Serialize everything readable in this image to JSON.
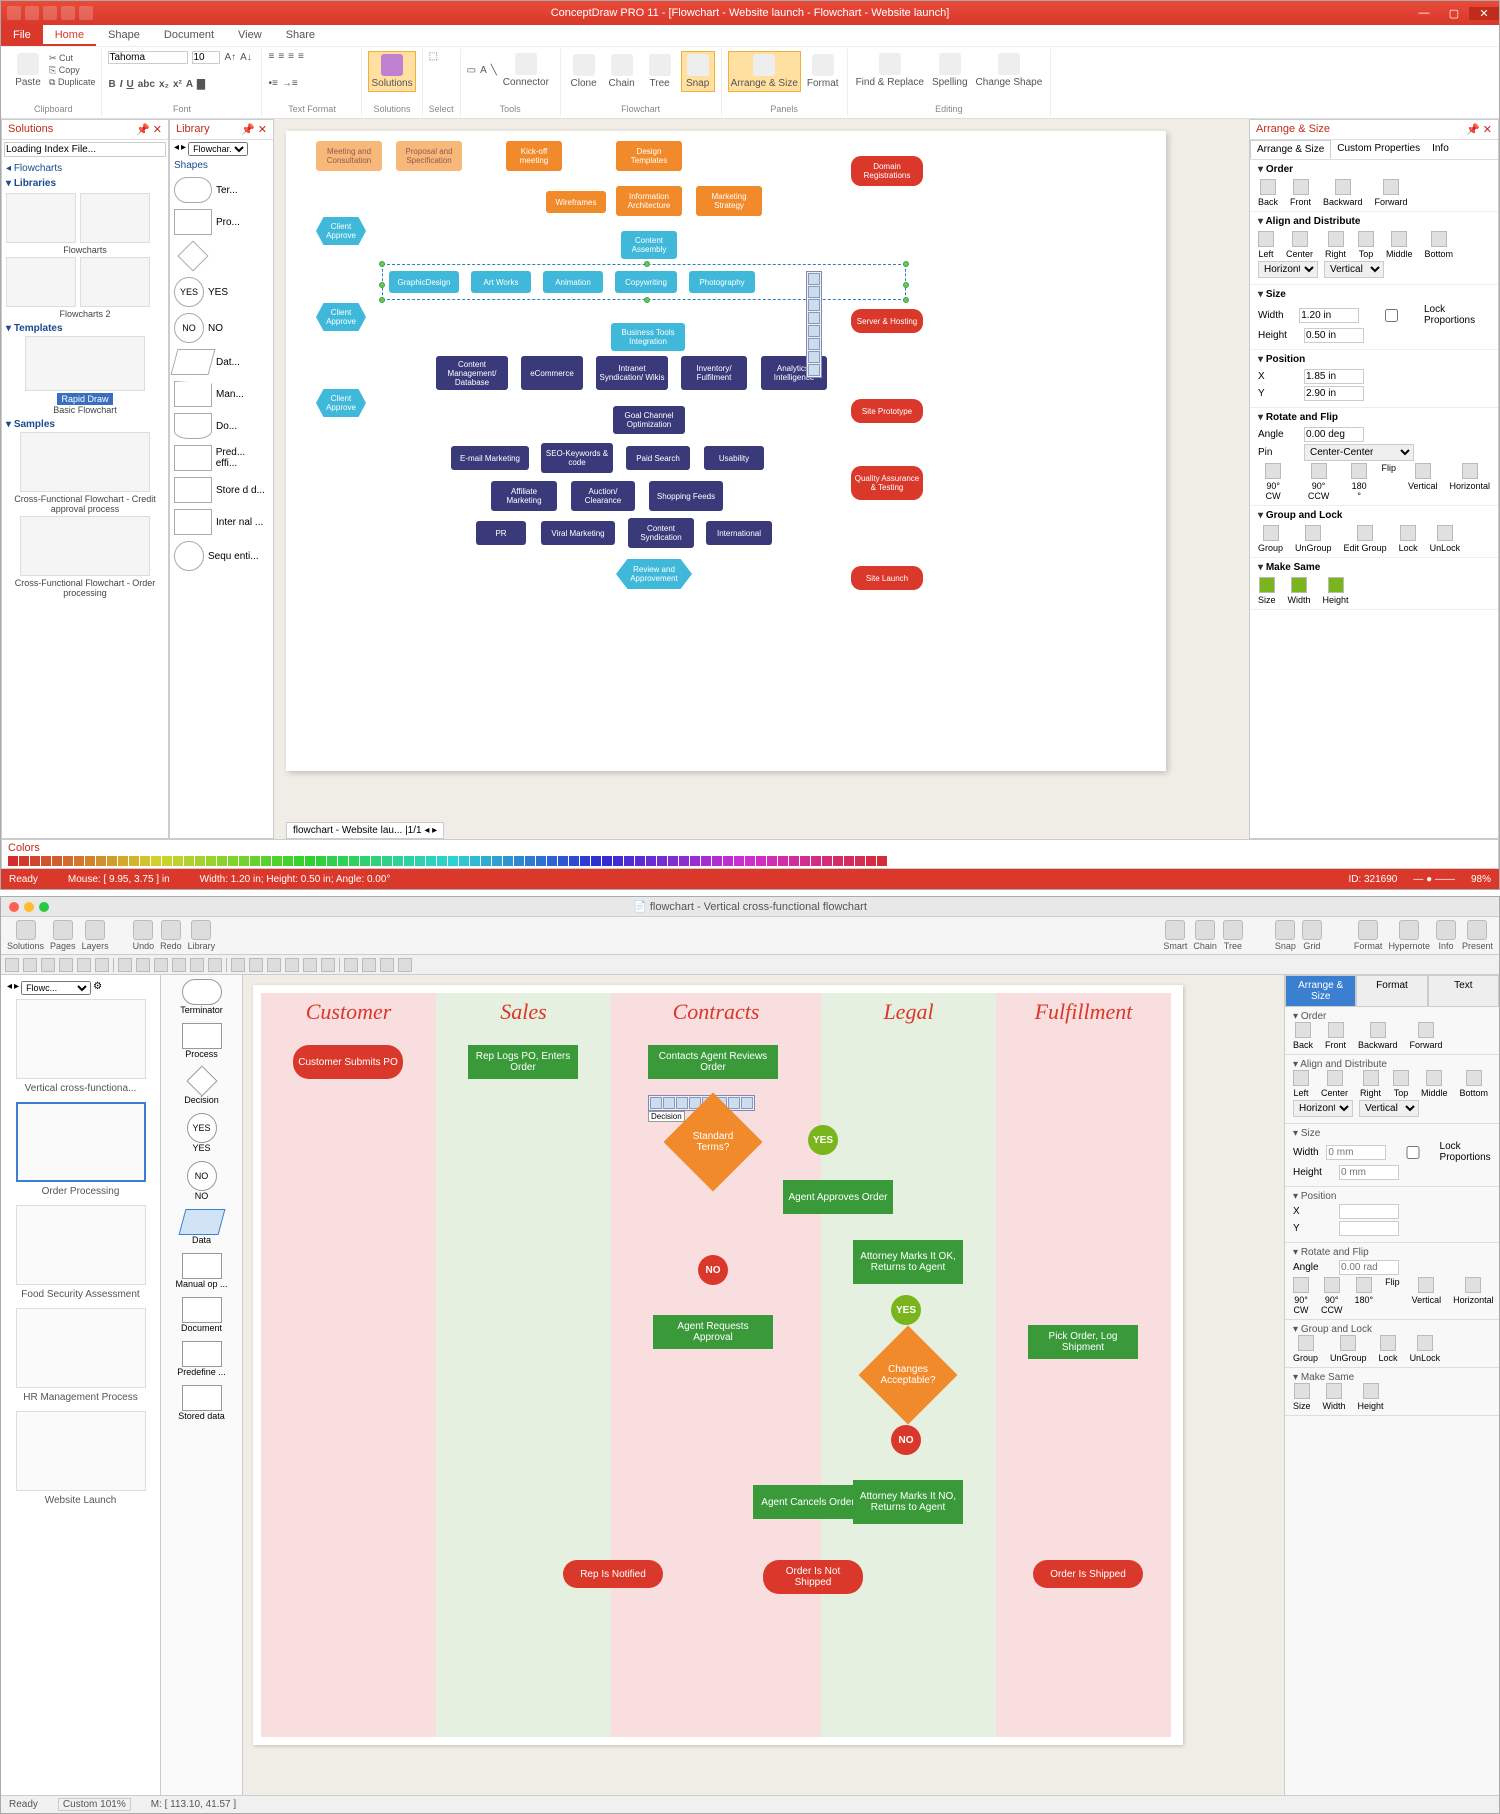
{
  "top": {
    "title": "ConceptDraw PRO 11 - [Flowchart - Website launch - Flowchart - Website launch]",
    "menu": {
      "file": "File",
      "home": "Home",
      "shape": "Shape",
      "document": "Document",
      "view": "View",
      "share": "Share"
    },
    "ribbon_groups": {
      "clipboard": "Clipboard",
      "font": "Font",
      "text_format": "Text Format",
      "solutions": "Solutions",
      "select": "Select",
      "tools": "Tools",
      "flowchart": "Flowchart",
      "panels": "Panels",
      "editing": "Editing"
    },
    "clipboard": {
      "paste": "Paste",
      "cut": "Cut",
      "copy": "Copy",
      "duplicate": "Duplicate"
    },
    "font": {
      "name": "Tahoma",
      "size": "10"
    },
    "solutions_btn": "Solutions",
    "tools": {
      "connector": "Connector"
    },
    "flowchart": {
      "clone": "Clone",
      "chain": "Chain",
      "tree": "Tree",
      "snap": "Snap",
      "arrange": "Arrange & Size",
      "format": "Format",
      "find": "Find & Replace",
      "spelling": "Spelling",
      "change_shape": "Change Shape"
    },
    "solutions_panel": {
      "title": "Solutions",
      "search": "Loading Index File...",
      "root": "Flowcharts",
      "sections": {
        "libraries": "Libraries",
        "templates": "Templates",
        "samples": "Samples"
      },
      "lib1": "Flowcharts",
      "lib2": "Flowcharts 2",
      "tmpl1_badge": "Rapid Draw",
      "tmpl1": "Basic Flowchart",
      "samp1": "Cross-Functional Flowchart - Credit approval process",
      "samp2": "Cross-Functional Flowchart - Order processing"
    },
    "library_panel": {
      "title": "Library",
      "tab": "Flowchar...",
      "section": "Shapes",
      "items": [
        "Ter...",
        "Pro...",
        "",
        "YES",
        "NO",
        "Dat...",
        "Man...",
        "Do...",
        "Pred... effi...",
        "Store d d...",
        "Inter nal ...",
        "Sequ enti..."
      ]
    },
    "canvas_nodes": {
      "n1": "Meeting and Consultation",
      "n2": "Proposal and Specification",
      "n3": "Kick-off meeting",
      "n4": "Design Templates",
      "n5": "Wireframes",
      "n6": "Information Architecture",
      "n7": "Marketing Strategy",
      "n8": "Client Approve",
      "n9": "Content Assembly",
      "n10": "GraphicDesign",
      "n11": "Art Works",
      "n12": "Animation",
      "n13": "Copywriting",
      "n14": "Photography",
      "n15": "Client Approve",
      "n16": "Business Tools Integration",
      "n17": "Content Management/ Database",
      "n18": "eCommerce",
      "n19": "Intranet Syndication/ Wikis",
      "n20": "Inventory/ Fulfilment",
      "n21": "Analytics/ Intelligence",
      "n22": "Client Approve",
      "n23": "Goal Channel Optimization",
      "n24": "E-mail Marketing",
      "n25": "SEO-Keywords & code",
      "n26": "Paid Search",
      "n27": "Usability",
      "n28": "Affiliate Marketing",
      "n29": "Auction/ Clearance",
      "n30": "Shopping Feeds",
      "n31": "PR",
      "n32": "Viral Marketing",
      "n33": "Content Syndication",
      "n34": "International",
      "n35": "Review and Approvement",
      "r1": "Domain Registrations",
      "r2": "Server & Hosting",
      "r3": "Site Prototype",
      "r4": "Quality Assurance & Testing",
      "r5": "Site Launch"
    },
    "doc_tab": "flowchart - Website lau...  |1/1",
    "colors_title": "Colors",
    "arrange": {
      "title": "Arrange & Size",
      "tabs": {
        "t1": "Arrange & Size",
        "t2": "Custom Properties",
        "t3": "Info"
      },
      "order": {
        "hdr": "Order",
        "back": "Back",
        "front": "Front",
        "backward": "Backward",
        "forward": "Forward"
      },
      "align": {
        "hdr": "Align and Distribute",
        "left": "Left",
        "center": "Center",
        "right": "Right",
        "top": "Top",
        "middle": "Middle",
        "bottom": "Bottom",
        "horiz": "Horizontal",
        "vert": "Vertical"
      },
      "size": {
        "hdr": "Size",
        "wlabel": "Width",
        "w": "1.20 in",
        "hlabel": "Height",
        "h": "0.50 in",
        "lock": "Lock Proportions"
      },
      "position": {
        "hdr": "Position",
        "xlabel": "X",
        "x": "1.85 in",
        "ylabel": "Y",
        "y": "2.90 in"
      },
      "rotate": {
        "hdr": "Rotate and Flip",
        "alabel": "Angle",
        "a": "0.00 deg",
        "plabel": "Pin",
        "pin": "Center-Center",
        "cw": "90° CW",
        "ccw": "90° CCW",
        "r180": "180 °",
        "flip": "Flip",
        "fv": "Vertical",
        "fh": "Horizontal"
      },
      "group": {
        "hdr": "Group and Lock",
        "group": "Group",
        "ungroup": "UnGroup",
        "edit": "Edit Group",
        "lock": "Lock",
        "unlock": "UnLock"
      },
      "make_same": {
        "hdr": "Make Same",
        "size": "Size",
        "width": "Width",
        "height": "Height"
      }
    },
    "status": {
      "ready": "Ready",
      "mouse": "Mouse: [ 9.95, 3.75 ] in",
      "dims": "Width: 1.20 in; Height: 0.50 in; Angle: 0.00°",
      "id": "ID: 321690",
      "zoom": "98%"
    }
  },
  "bottom": {
    "title": "flowchart - Vertical cross-functional flowchart",
    "toolbar": {
      "solutions": "Solutions",
      "pages": "Pages",
      "layers": "Layers",
      "undo": "Undo",
      "redo": "Redo",
      "library": "Library",
      "smart": "Smart",
      "chain": "Chain",
      "tree": "Tree",
      "snap": "Snap",
      "grid": "Grid",
      "format": "Format",
      "hypernote": "Hypernote",
      "info": "Info",
      "present": "Present"
    },
    "sidebar": {
      "tab": "Flowc...",
      "items": [
        "Vertical cross-functiona...",
        "Order Processing",
        "Food Security Assessment",
        "HR Management Process",
        "Website Launch"
      ]
    },
    "shapes": [
      "Terminator",
      "Process",
      "Decision",
      "YES",
      "NO",
      "Data",
      "Manual op ...",
      "Document",
      "Predefine ...",
      "Stored data"
    ],
    "shapes_sel_index": 5,
    "lanes": {
      "l1": "Customer",
      "l2": "Sales",
      "l3": "Contracts",
      "l4": "Legal",
      "l5": "Fulfillment"
    },
    "nodes": {
      "a": "Customer Submits PO",
      "b": "Rep Logs PO, Enters Order",
      "c": "Contacts Agent Reviews Order",
      "d": "Standard Terms?",
      "d_label": "Decision",
      "e": "YES",
      "f": "Agent Approves Order",
      "g": "Attorney Marks It OK, Returns to Agent",
      "h": "YES",
      "i": "Changes Acceptable?",
      "j": "NO",
      "k": "Agent Requests Approval",
      "l": "NO",
      "m": "Pick Order, Log Shipment",
      "n": "Agent Cancels Order",
      "o": "Attorney Marks It NO, Returns to Agent",
      "p": "Rep Is Notified",
      "q": "Order Is Not Shipped",
      "r": "Order Is Shipped"
    },
    "inspector": {
      "tabs": {
        "t1": "Arrange & Size",
        "t2": "Format",
        "t3": "Text"
      },
      "order": {
        "hdr": "Order",
        "back": "Back",
        "front": "Front",
        "backward": "Backward",
        "forward": "Forward"
      },
      "align": {
        "hdr": "Align and Distribute",
        "left": "Left",
        "center": "Center",
        "right": "Right",
        "top": "Top",
        "middle": "Middle",
        "bottom": "Bottom",
        "horiz": "Horizontal",
        "vert": "Vertical"
      },
      "size": {
        "hdr": "Size",
        "wlabel": "Width",
        "w": "0 mm",
        "hlabel": "Height",
        "h": "0 mm",
        "lock": "Lock Proportions"
      },
      "position": {
        "hdr": "Position",
        "xlabel": "X",
        "x": "",
        "ylabel": "Y",
        "y": ""
      },
      "rotate": {
        "hdr": "Rotate and Flip",
        "alabel": "Angle",
        "a": "0.00 rad",
        "cw": "90° CW",
        "ccw": "90° CCW",
        "r180": "180°",
        "flip": "Flip",
        "fv": "Vertical",
        "fh": "Horizontal"
      },
      "group": {
        "hdr": "Group and Lock",
        "group": "Group",
        "ungroup": "UnGroup",
        "lock": "Lock",
        "unlock": "UnLock"
      },
      "make_same": {
        "hdr": "Make Same",
        "size": "Size",
        "width": "Width",
        "height": "Height"
      }
    },
    "status": {
      "ready": "Ready",
      "custom": "Custom 101%",
      "mouse": "M: [ 113.10, 41.57 ]"
    }
  }
}
